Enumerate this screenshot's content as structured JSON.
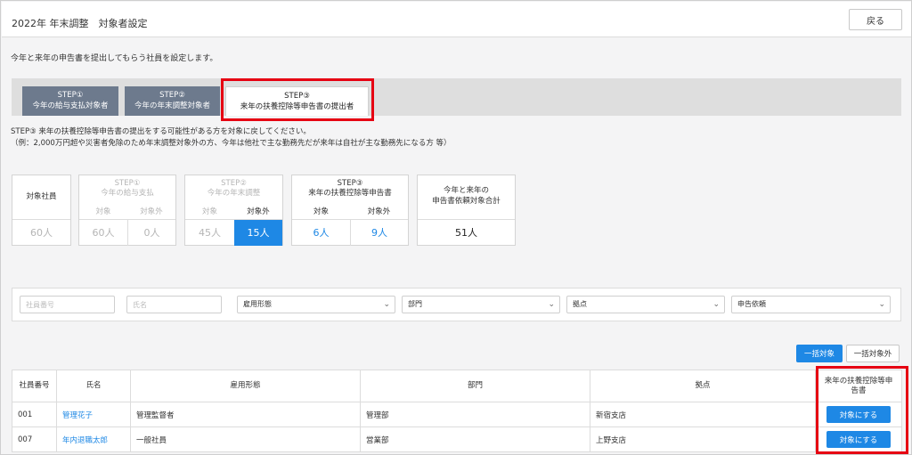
{
  "header": {
    "title": "2022年 年末調整　対象者設定",
    "back_label": "戻る"
  },
  "description": "今年と来年の申告書を提出してもらう社員を設定します。",
  "tabs": [
    {
      "line1": "STEP①",
      "line2": "今年の給与支払対象者"
    },
    {
      "line1": "STEP②",
      "line2": "今年の年末調整対象者"
    },
    {
      "line1": "STEP③",
      "line2": "来年の扶養控除等申告書の提出者"
    }
  ],
  "step_desc": {
    "line1": "STEP③ 来年の扶養控除等申告書の提出をする可能性がある方を対象に戻してください。",
    "line2": "（例：2,000万円超や災害者免除のため年末調整対象外の方、今年は他社で主な勤務先だが来年は自社が主な勤務先になる方 等）"
  },
  "summary": {
    "employees": {
      "label": "対象社員",
      "value": "60人"
    },
    "step1": {
      "line1": "STEP①",
      "line2": "今年の給与支払",
      "sub_target": "対象",
      "sub_excluded": "対象外",
      "target": "60人",
      "excluded": "0人"
    },
    "step2": {
      "line1": "STEP②",
      "line2": "今年の年末調整",
      "sub_target": "対象",
      "sub_excluded": "対象外",
      "target": "45人",
      "excluded": "15人"
    },
    "step3": {
      "line1": "STEP③",
      "line2": "来年の扶養控除等申告書",
      "sub_target": "対象",
      "sub_excluded": "対象外",
      "target": "6人",
      "excluded": "9人"
    },
    "total": {
      "line1": "今年と来年の",
      "line2": "申告書依頼対象合計",
      "value": "51人"
    }
  },
  "filters": {
    "employee_no_placeholder": "社員番号",
    "name_placeholder": "氏名",
    "employment_type": "雇用形態",
    "department": "部門",
    "location": "拠点",
    "request": "申告依頼"
  },
  "bulk": {
    "target_label": "一括対象",
    "excluded_label": "一括対象外"
  },
  "table": {
    "columns": [
      "社員番号",
      "氏名",
      "雇用形態",
      "部門",
      "拠点",
      "来年の扶養控除等申告書"
    ],
    "rows": [
      {
        "no": "001",
        "name": "管理花子",
        "type": "管理監督者",
        "dept": "管理部",
        "location": "新宿支店",
        "action": "対象にする"
      },
      {
        "no": "007",
        "name": "年内退職太郎",
        "type": "一般社員",
        "dept": "営業部",
        "location": "上野支店",
        "action": "対象にする"
      }
    ]
  },
  "colors": {
    "accent": "#1e88e5",
    "tab_inactive": "#6d7a8d",
    "highlight_box": "#e60012"
  }
}
